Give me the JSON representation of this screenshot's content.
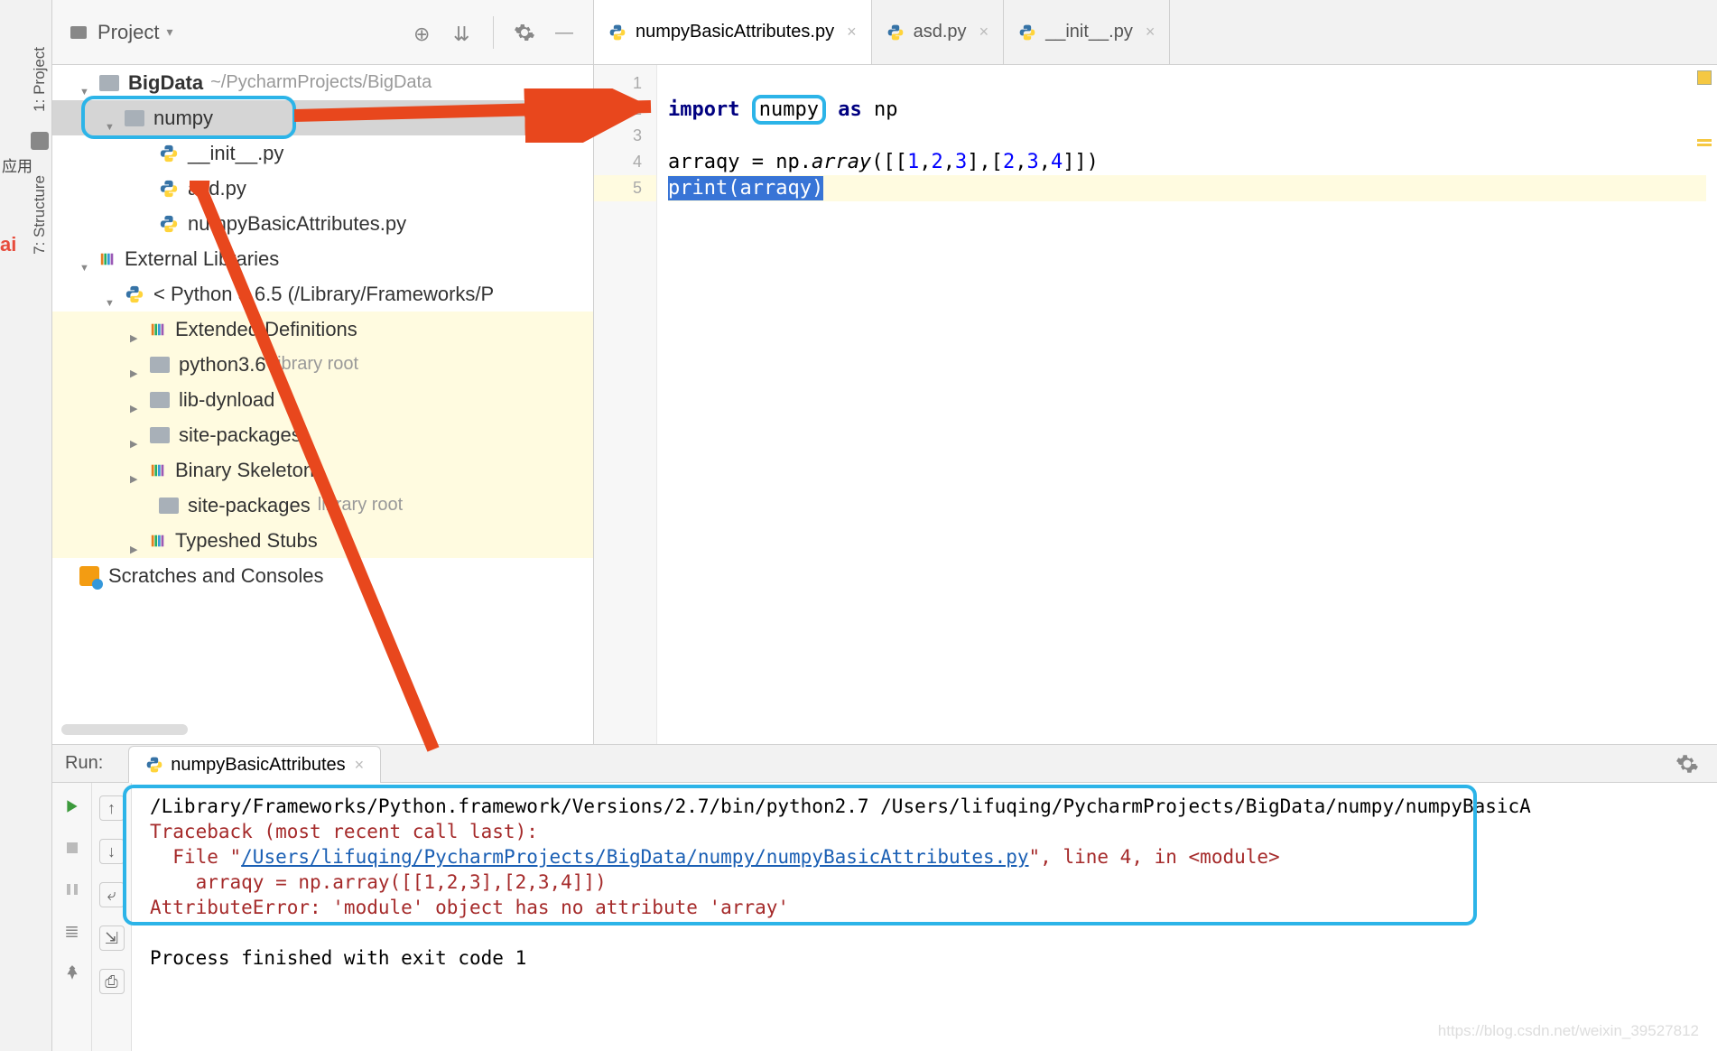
{
  "sidebar": {
    "project_tab": "1: Project",
    "structure_tab": "7: Structure",
    "app_badge": "应用",
    "ai_badge": "ai"
  },
  "project_header": {
    "label": "Project"
  },
  "tree": {
    "root": {
      "name": "BigData",
      "path": "~/PycharmProjects/BigData"
    },
    "numpy_folder": "numpy",
    "files": [
      "__init__.py",
      "asd.py",
      "numpyBasicAttributes.py"
    ],
    "ext_lib": "External Libraries",
    "python_env": "< Python 3.6.5 (/Library/Frameworks/P",
    "ext_def": "Extended Definitions",
    "py36": {
      "name": "python3.6",
      "suffix": "library root"
    },
    "libdyn": "lib-dynload",
    "sitepkg": "site-packages",
    "binskel": "Binary Skeletons",
    "sitepkg2": {
      "name": "site-packages",
      "suffix": "library root"
    },
    "typeshed": "Typeshed Stubs",
    "scratches": "Scratches and Consoles"
  },
  "tabs": [
    {
      "name": "numpyBasicAttributes.py",
      "active": true
    },
    {
      "name": "asd.py",
      "active": false
    },
    {
      "name": "__init__.py",
      "active": false
    }
  ],
  "code": {
    "kw_import": "import",
    "mod_numpy": "numpy",
    "kw_as": "as",
    "alias": "np",
    "line4_prefix": "arraqy = np.",
    "line4_func": "array",
    "line4_args": "([[",
    "n1": "1",
    "n2": "2",
    "n3": "3",
    "n4": "2",
    "n5": "3",
    "n6": "4",
    "line4_close": "]])",
    "line5_print": "print",
    "line5_arg": "(arraqy)"
  },
  "run": {
    "label": "Run:",
    "tab": "numpyBasicAttributes"
  },
  "console": {
    "line1": "/Library/Frameworks/Python.framework/Versions/2.7/bin/python2.7 /Users/lifuqing/PycharmProjects/BigData/numpy/numpyBasicA",
    "line2": "Traceback (most recent call last):",
    "line3a": "  File \"",
    "line3b": "/Users/lifuqing/PycharmProjects/BigData/numpy/numpyBasicAttributes.py",
    "line3c": "\", line 4, in <module>",
    "line4": "    arraqy = np.array([[1,2,3],[2,3,4]])",
    "line5": "AttributeError: 'module' object has no attribute 'array'",
    "line7": "Process finished with exit code 1"
  },
  "watermark": "https://blog.csdn.net/weixin_39527812"
}
